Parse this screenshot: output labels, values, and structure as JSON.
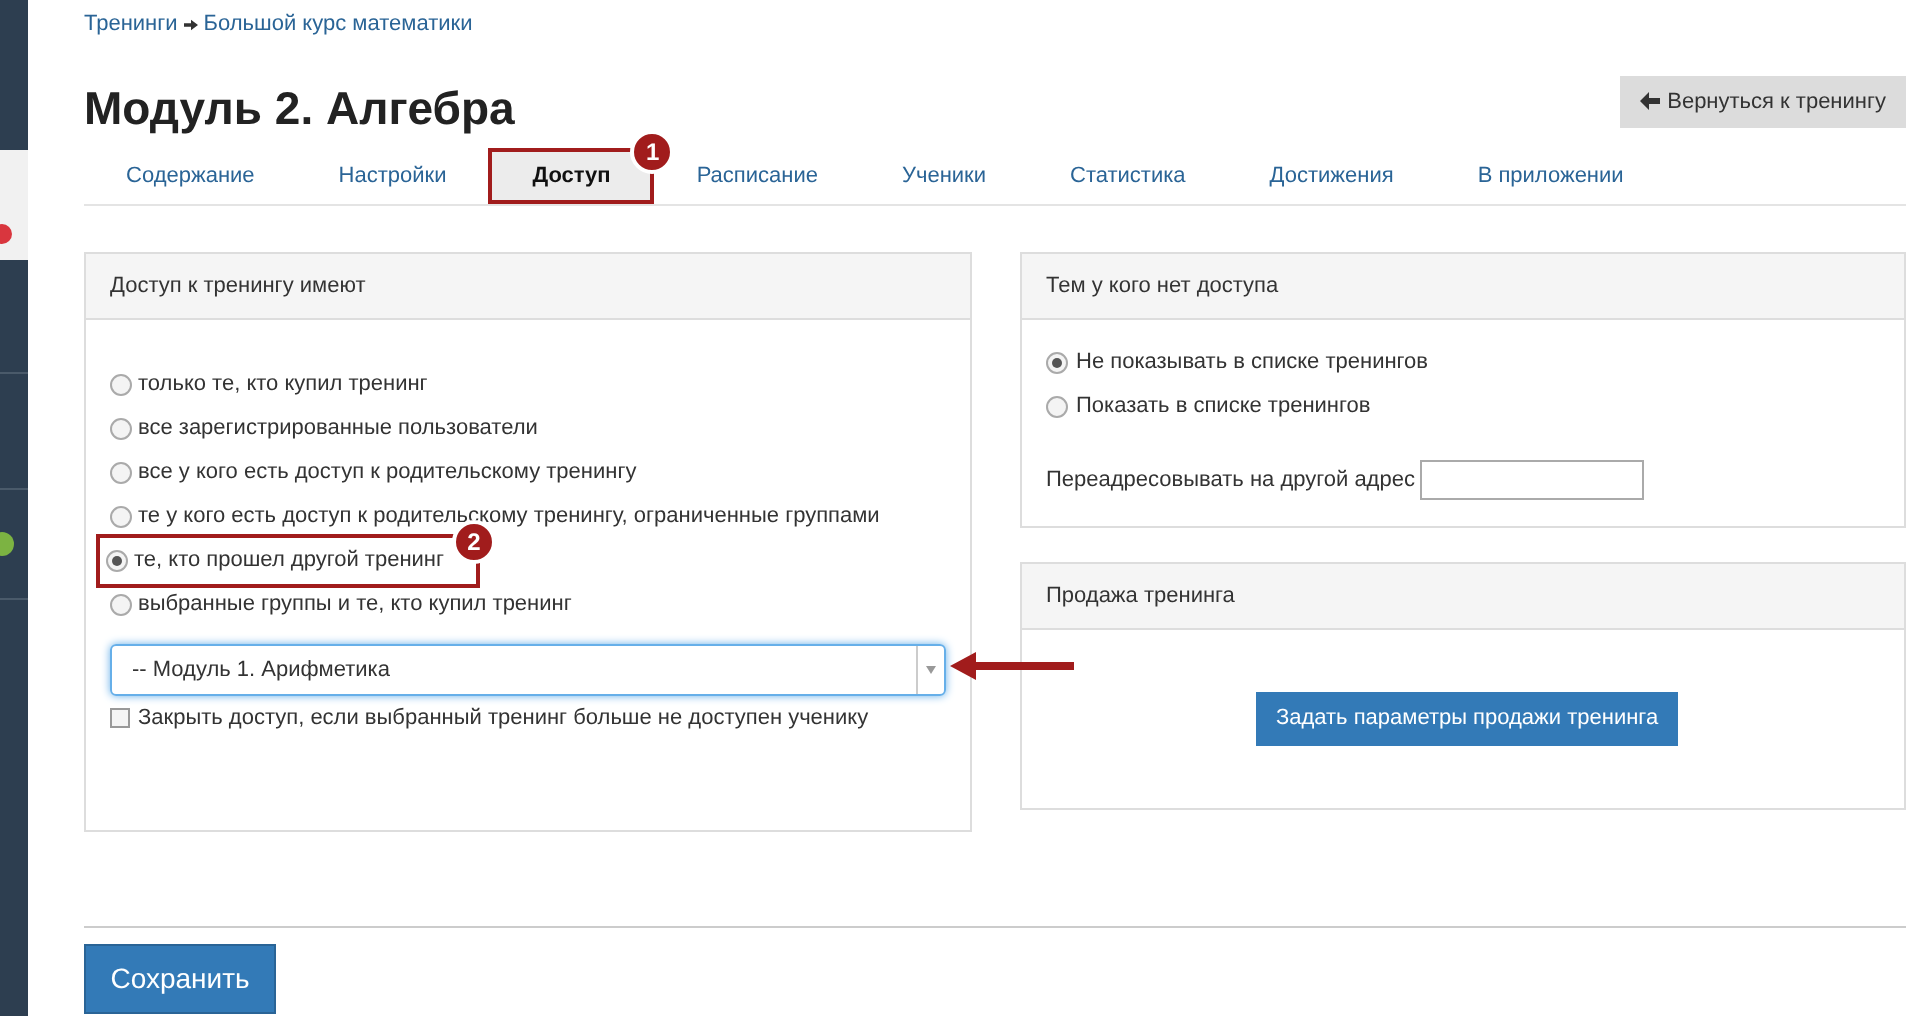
{
  "breadcrumb": {
    "parent": "Тренинги",
    "current": "Большой курс математики"
  },
  "title": "Модуль 2. Алгебра",
  "back_button": "Вернуться к тренингу",
  "tabs": [
    {
      "label": "Содержание",
      "selected": false
    },
    {
      "label": "Настройки",
      "selected": false
    },
    {
      "label": "Доступ",
      "selected": true,
      "badge": "1"
    },
    {
      "label": "Расписание",
      "selected": false
    },
    {
      "label": "Ученики",
      "selected": false
    },
    {
      "label": "Статистика",
      "selected": false
    },
    {
      "label": "Достижения",
      "selected": false
    },
    {
      "label": "В приложении",
      "selected": false
    }
  ],
  "access_panel": {
    "title": "Доступ к тренингу имеют",
    "options": [
      {
        "label": "только те, кто купил тренинг",
        "selected": false
      },
      {
        "label": "все зарегистрированные пользователи",
        "selected": false
      },
      {
        "label": "все у кого есть доступ к родительскому тренингу",
        "selected": false
      },
      {
        "label": "те у кого есть доступ к родительскому тренингу, ограниченные группами",
        "selected": false
      },
      {
        "label": "те, кто прошел другой тренинг",
        "selected": true,
        "badge": "2"
      },
      {
        "label": "выбранные группы и те, кто купил тренинг",
        "selected": false
      }
    ],
    "select": {
      "value": "-- Модуль 1. Арифметика",
      "arrow": true
    },
    "checkbox": {
      "label": "Закрыть доступ, если выбранный тренинг больше не доступен ученику",
      "checked": false
    }
  },
  "no_access_panel": {
    "title": "Тем у кого нет доступа",
    "options": [
      {
        "label": "Не показывать в списке тренингов",
        "selected": true
      },
      {
        "label": "Показать в списке тренингов",
        "selected": false
      }
    ],
    "redirect_label": "Переадресовывать на другой адрес"
  },
  "sale_panel": {
    "title": "Продажа тренинга",
    "button": "Задать параметры продажи тренинга"
  },
  "save_button": "Сохранить"
}
